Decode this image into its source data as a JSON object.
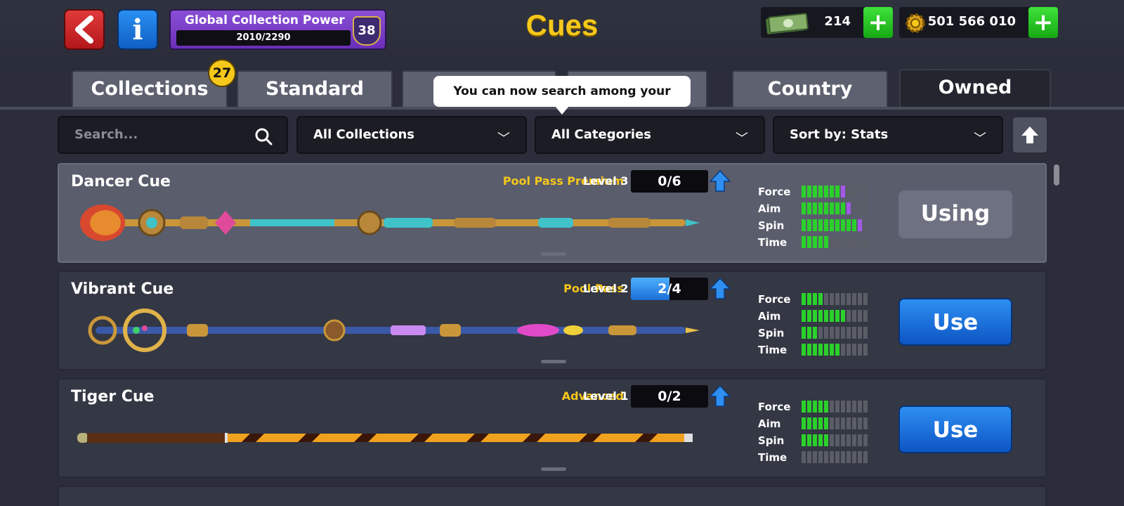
{
  "header": {
    "title": "Cues",
    "collection_power": {
      "label": "Global Collection Power",
      "progress": "2010/2290",
      "level": "38"
    },
    "cash": {
      "value": "214"
    },
    "coins": {
      "value": "501 566 010"
    }
  },
  "tabs": [
    {
      "label": "Collections",
      "badge": "27"
    },
    {
      "label": "Standard"
    },
    {
      "label": ""
    },
    {
      "label": ""
    },
    {
      "label": "Country"
    },
    {
      "label": "Owned",
      "active": true
    }
  ],
  "tooltip": "You can now search among your cues!",
  "filters": {
    "search_placeholder": "Search...",
    "collections": "All Collections",
    "categories": "All Categories",
    "sort": "Sort by: Stats"
  },
  "stat_labels": {
    "force": "Force",
    "aim": "Aim",
    "spin": "Spin",
    "time": "Time"
  },
  "cues": [
    {
      "name": "Dancer Cue",
      "tier": "Pool Pass Premium",
      "level": "Level 3",
      "progress": "0/6",
      "progress_fraction": 0,
      "stats": {
        "force": [
          7,
          1
        ],
        "aim": [
          8,
          1
        ],
        "spin": [
          10,
          1
        ],
        "time": [
          5,
          0
        ]
      },
      "action": "Using"
    },
    {
      "name": "Vibrant Cue",
      "tier": "Pool Pass",
      "level": "Level 2",
      "progress": "2/4",
      "progress_fraction": 0.5,
      "stats": {
        "force": [
          4,
          0
        ],
        "aim": [
          8,
          0
        ],
        "spin": [
          3,
          0
        ],
        "time": [
          7,
          0
        ]
      },
      "action": "Use"
    },
    {
      "name": "Tiger Cue",
      "tier": "Advanced",
      "level": "Level 1",
      "progress": "0/2",
      "progress_fraction": 0,
      "stats": {
        "force": [
          5,
          0
        ],
        "aim": [
          5,
          0
        ],
        "spin": [
          5,
          0
        ],
        "time": [
          0,
          0
        ]
      },
      "action": "Use"
    }
  ],
  "colors": {
    "accent_yellow": "#f6c81b",
    "green": "#2bd12b",
    "purple": "#a258e6",
    "blue_button": "#1a6fd6"
  }
}
